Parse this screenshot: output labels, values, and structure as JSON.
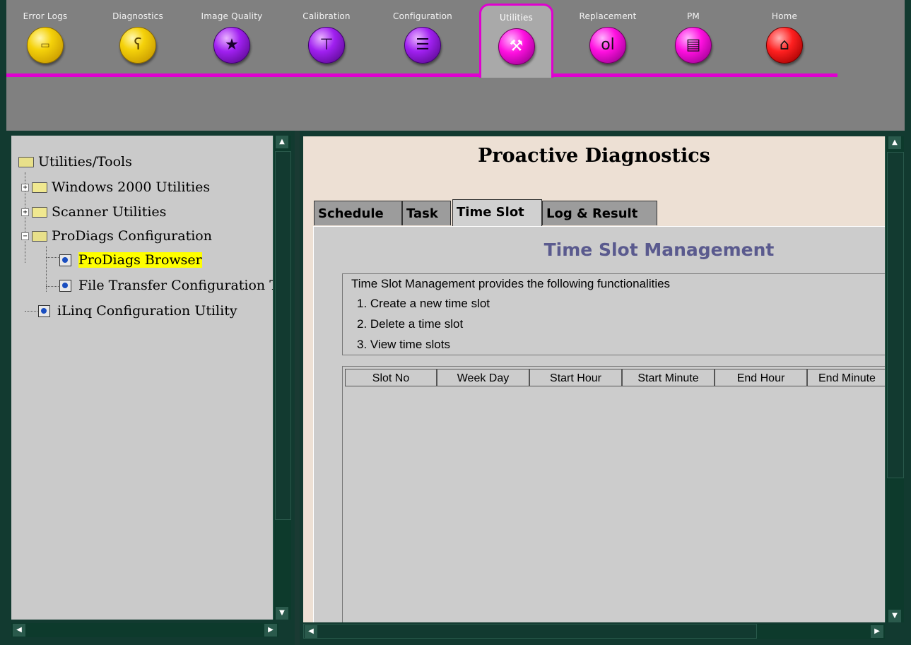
{
  "toolbar": {
    "items": [
      {
        "label": "Error Logs",
        "icon": "error-log-icon"
      },
      {
        "label": "Diagnostics",
        "icon": "stethoscope-icon"
      },
      {
        "label": "Image Quality",
        "icon": "image-quality-icon"
      },
      {
        "label": "Calibration",
        "icon": "calibration-icon"
      },
      {
        "label": "Configuration",
        "icon": "configuration-icon"
      },
      {
        "label": "Utilities",
        "icon": "toolbox-icon",
        "selected": true
      },
      {
        "label": "Replacement",
        "icon": "replacement-icon"
      },
      {
        "label": "PM",
        "icon": "pm-checklist-icon"
      },
      {
        "label": "Home",
        "icon": "home-icon"
      }
    ],
    "accent_color": "#e000d0"
  },
  "tree": {
    "root": "Utilities/Tools",
    "items": [
      {
        "label": "Windows 2000 Utilities",
        "expander": "+"
      },
      {
        "label": "Scanner Utilities",
        "expander": "+"
      },
      {
        "label": "ProDiags Configuration",
        "expander": "−"
      },
      {
        "label": "ProDiags Browser",
        "selected": true
      },
      {
        "label": "File Transfer Configuration T"
      },
      {
        "label": "iLinq Configuration Utility"
      }
    ]
  },
  "main": {
    "title": "Proactive Diagnostics",
    "tabs": [
      "Schedule",
      "Task",
      "Time Slot",
      "Log & Result"
    ],
    "active_tab": "Time Slot",
    "panel_heading": "Time Slot Management",
    "info_lines": [
      "Time Slot Management provides the following functionalities",
      "1. Create a new time slot",
      "2. Delete a time slot",
      "3. View time slots"
    ],
    "table": {
      "columns": [
        "Slot No",
        "Week Day",
        "Start Hour",
        "Start Minute",
        "End Hour",
        "End Minute"
      ],
      "rows": []
    }
  }
}
